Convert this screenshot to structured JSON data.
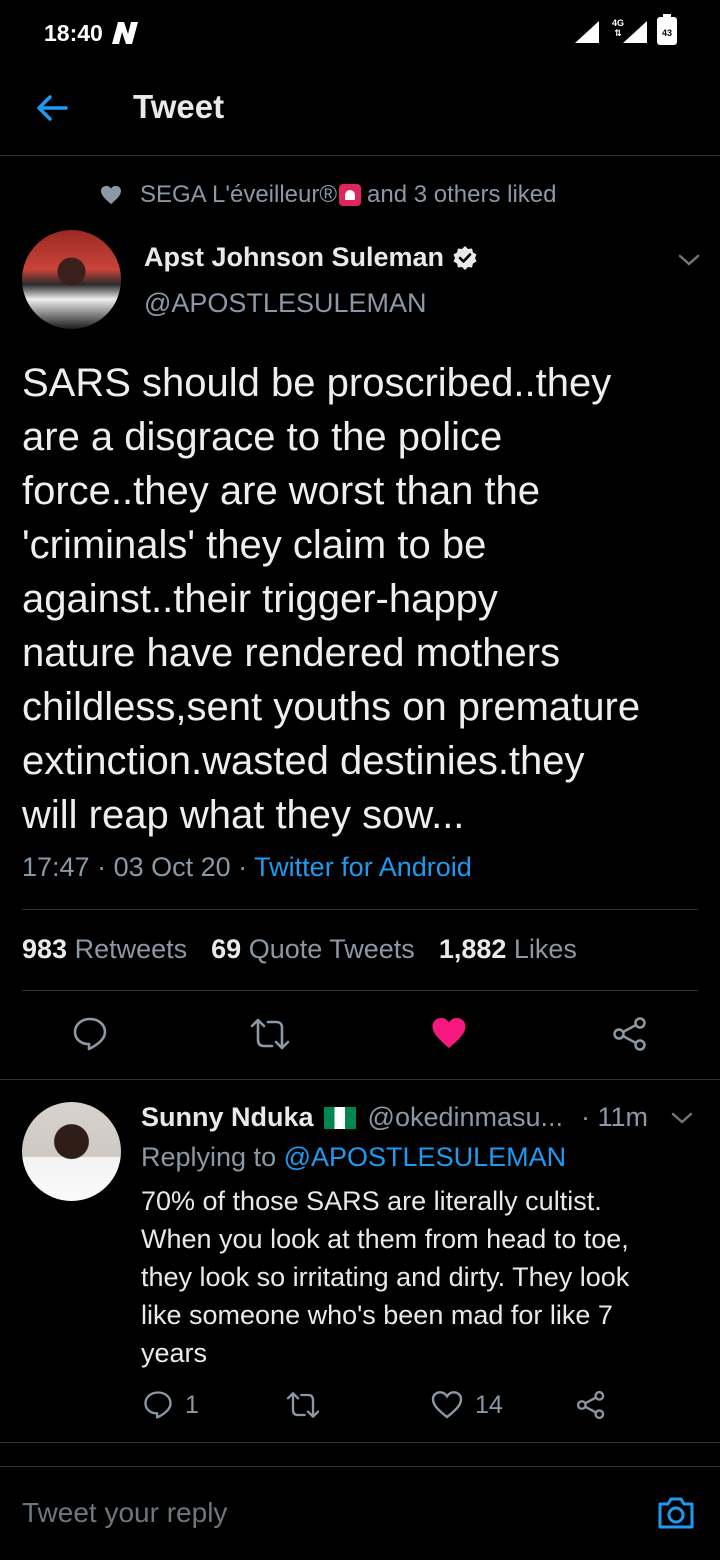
{
  "status_bar": {
    "time": "18:40",
    "network": "4G",
    "battery": "43"
  },
  "header": {
    "title": "Tweet",
    "back_icon": "arrow-left-icon"
  },
  "social_context": {
    "text_before": "SEGA L'éveilleur®",
    "text_after": "and 3 others liked"
  },
  "tweet": {
    "author_name": "Apst Johnson Suleman",
    "handle": "@APOSTLESULEMAN",
    "text": "SARS should be proscribed..they\nare a disgrace to the police\nforce..they are worst than the\n'criminals' they claim to be\nagainst..their trigger-happy\nnature have rendered mothers\nchildless,sent youths on premature\nextinction.wasted destinies.they\nwill reap what they sow...",
    "time": "17:47",
    "date": "03 Oct 20",
    "client": "Twitter for Android",
    "stats": {
      "retweets_count": "983",
      "retweets_label": "Retweets",
      "quotes_count": "69",
      "quotes_label": "Quote Tweets",
      "likes_count": "1,882",
      "likes_label": "Likes"
    },
    "liked_color": "#f91880"
  },
  "reply": {
    "author_name": "Sunny Nduka",
    "handle": "@okedinmasu...",
    "time": "11m",
    "replying_prefix": "Replying to",
    "replying_to": "@APOSTLESULEMAN",
    "text": "70% of those SARS are literally cultist.\nWhen you look at them from head to toe,\nthey look so irritating and dirty. They look\nlike someone who's been mad for like 7\nyears",
    "reply_count": "1",
    "like_count": "14"
  },
  "composer": {
    "placeholder": "Tweet your reply"
  },
  "colors": {
    "accent": "#1d9bf0",
    "background": "#000000",
    "muted": "#8b98a5"
  }
}
